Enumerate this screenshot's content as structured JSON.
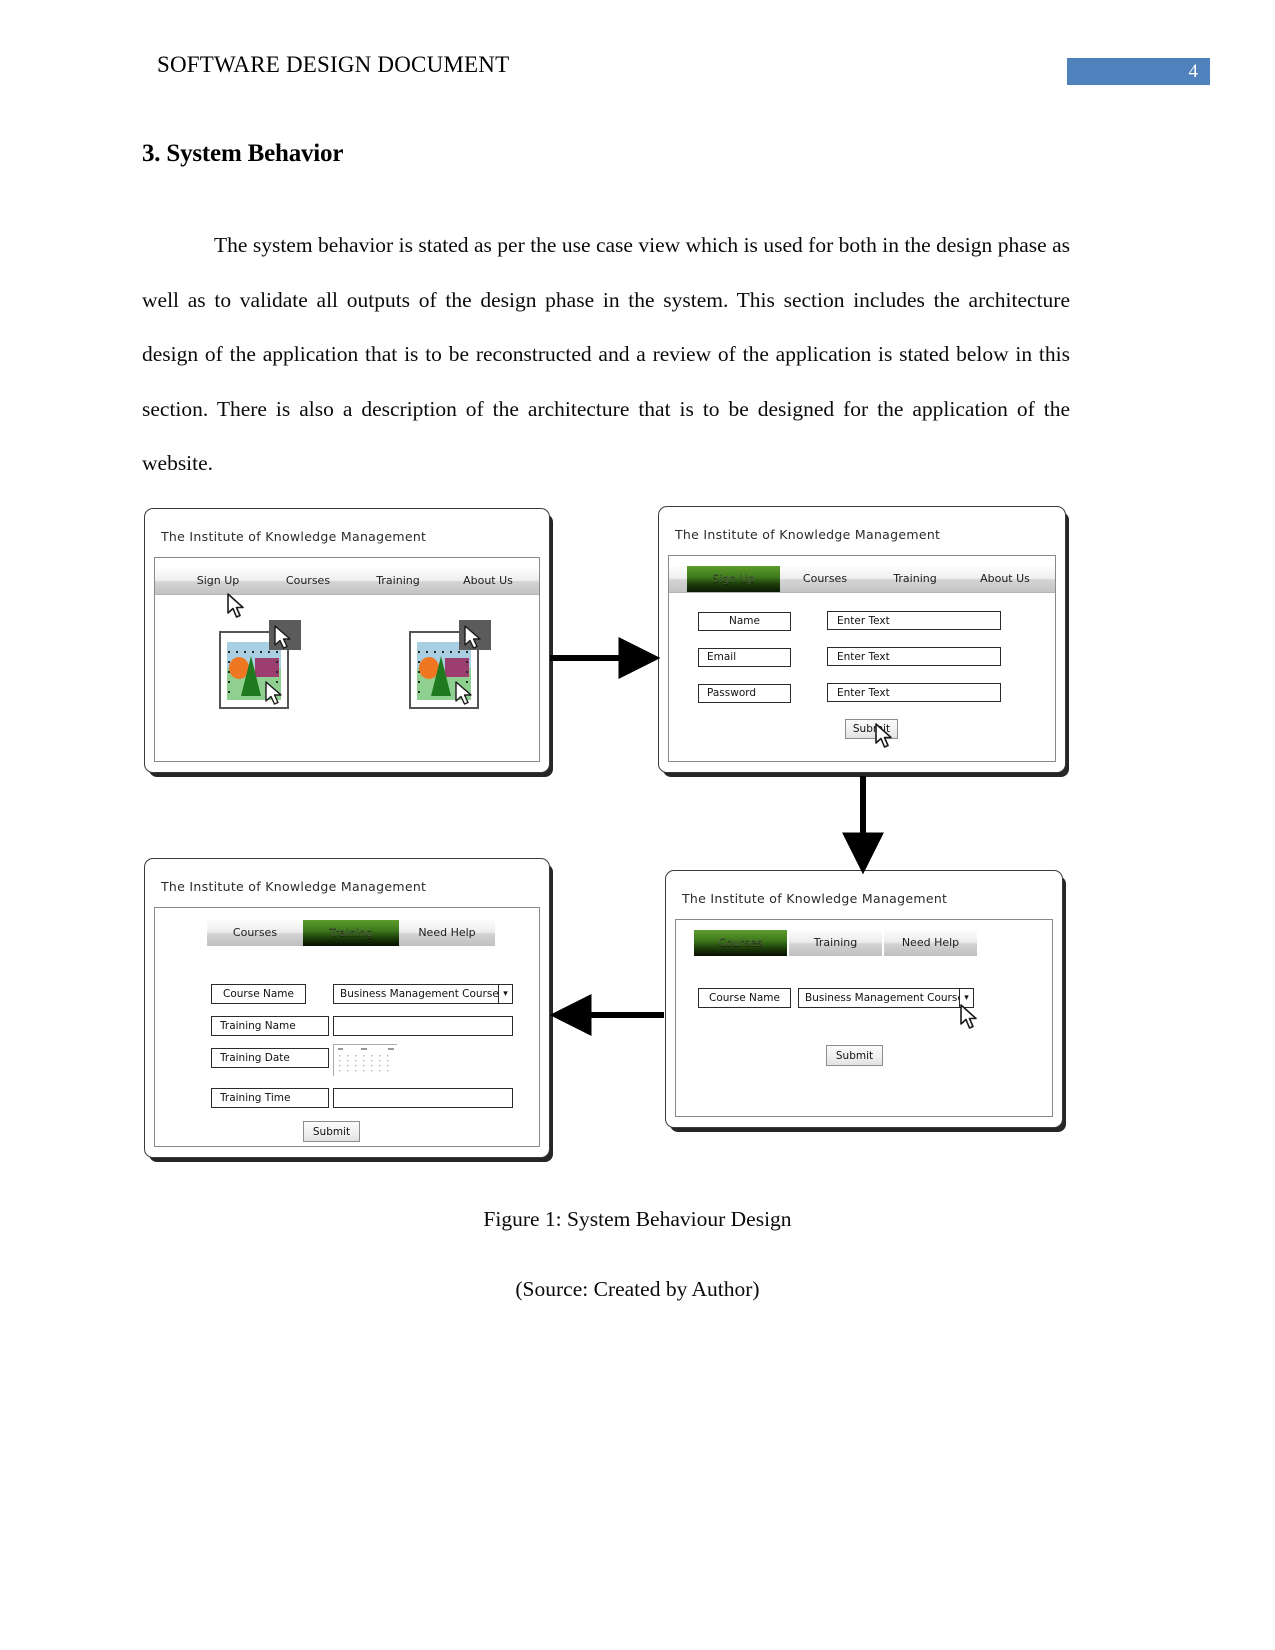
{
  "header": {
    "title": "SOFTWARE DESIGN DOCUMENT",
    "page_number": "4",
    "badge_color": "#4F81BD"
  },
  "section": {
    "heading": "3. System Behavior",
    "paragraph": "The system behavior is stated as per the use case view which is used for both in the design phase as well as to validate all outputs of the design phase in the system. This section includes the architecture design of the application that is to be reconstructed and a review of the application is stated below in this section. There is also a description of the architecture that is to be designed for the application of the website."
  },
  "figure": {
    "caption": "Figure 1: System Behaviour Design",
    "source": "(Source: Created by Author)",
    "active_tab_color": "#5d9b2c"
  },
  "mockups": {
    "home": {
      "title": "The Institute of Knowledge Management",
      "nav": [
        {
          "label": "Sign Up",
          "active": false
        },
        {
          "label": "Courses",
          "active": false
        },
        {
          "label": "Training",
          "active": false
        },
        {
          "label": "About Us",
          "active": false
        }
      ],
      "images": [
        "image-placeholder-1",
        "image-placeholder-2"
      ]
    },
    "signup": {
      "title": "The Institute of Knowledge Management",
      "nav": [
        {
          "label": "Sign Up",
          "active": true
        },
        {
          "label": "Courses",
          "active": false
        },
        {
          "label": "Training",
          "active": false
        },
        {
          "label": "About Us",
          "active": false
        }
      ],
      "fields": [
        {
          "label": "Name",
          "value": "Enter Text"
        },
        {
          "label": "Email",
          "value": "Enter Text"
        },
        {
          "label": "Password",
          "value": "Enter Text"
        }
      ],
      "submit_label": "Submit"
    },
    "training": {
      "title": "The Institute of Knowledge Management",
      "nav": [
        {
          "label": "Courses",
          "active": false
        },
        {
          "label": "Training",
          "active": true
        },
        {
          "label": "Need Help",
          "active": false
        }
      ],
      "course_label": "Course Name",
      "course_value": "Business Management Course",
      "fields": [
        {
          "label": "Training Name",
          "value": ""
        },
        {
          "label": "Training Date",
          "value": ""
        },
        {
          "label": "Training Time",
          "value": ""
        }
      ],
      "submit_label": "Submit"
    },
    "courses": {
      "title": "The Institute of Knowledge Management",
      "nav": [
        {
          "label": "Courses",
          "active": true
        },
        {
          "label": "Training",
          "active": false
        },
        {
          "label": "Need Help",
          "active": false
        }
      ],
      "course_label": "Course Name",
      "course_value": "Business Management Course",
      "submit_label": "Submit"
    }
  }
}
